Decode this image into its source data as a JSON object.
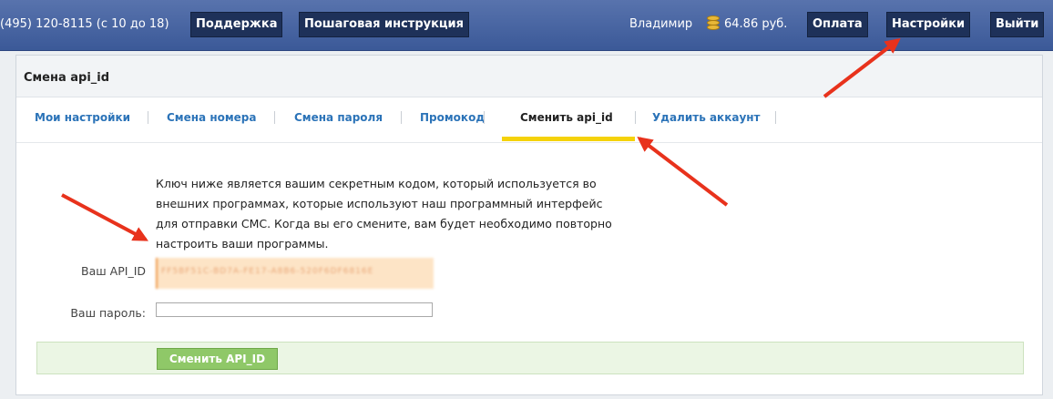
{
  "topbar": {
    "phone": "(495) 120-8115 (с 10 до 18)",
    "support_label": "Поддержка",
    "guide_label": "Пошаговая инструкция",
    "user_name": "Владимир",
    "balance": "64.86 руб.",
    "payment_label": "Оплата",
    "settings_label": "Настройки",
    "logout_label": "Выйти"
  },
  "panel": {
    "title": "Смена api_id",
    "tabs": [
      {
        "label": "Мои настройки"
      },
      {
        "label": "Смена номера"
      },
      {
        "label": "Смена пароля"
      },
      {
        "label": "Промокод"
      },
      {
        "label": "Сменить api_id",
        "active": true
      },
      {
        "label": "Удалить аккаунт"
      }
    ],
    "description": "Ключ ниже является вашим секретным кодом, который используется во внешних программах, которые используют наш программный интерфейс для отправки СМС. Когда вы его смените, вам будет необходимо повторно настроить ваши программы.",
    "api_id_label": "Ваш API_ID",
    "api_id_value": "FF5BF51C-BD7A-FE17-A8B6-520F6DF6816E",
    "password_label": "Ваш пароль:",
    "password_value": "",
    "submit_label": "Сменить API_ID"
  },
  "colors": {
    "topbar": "#3b5998",
    "tab_link": "#2b73b8",
    "active_underline": "#f5d20a",
    "submit_button": "#8fc868",
    "annotation_arrow": "#e8321c"
  },
  "icons": [
    "coins-icon",
    "arrow-annotation"
  ]
}
